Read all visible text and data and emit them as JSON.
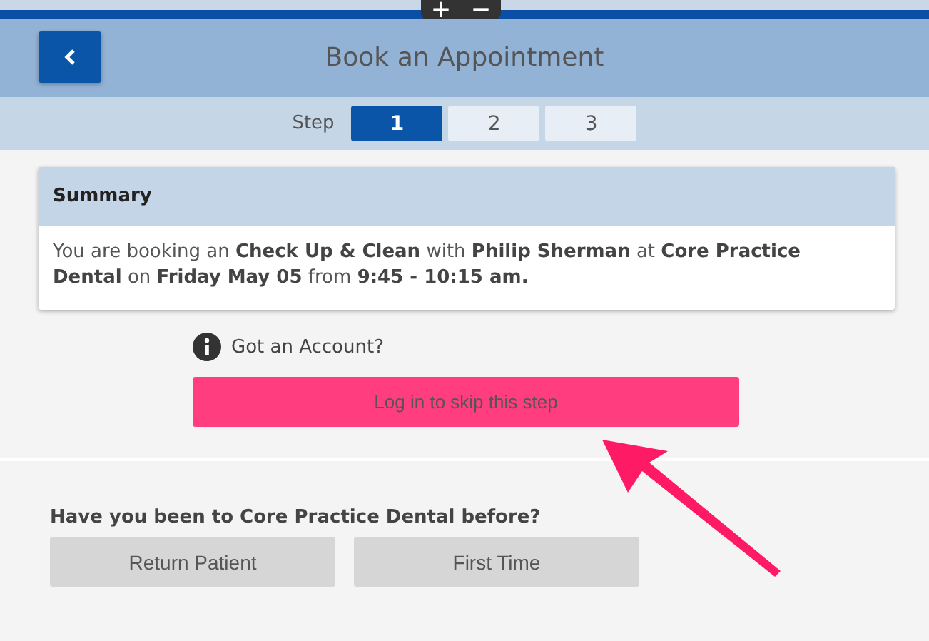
{
  "zoom_control": {
    "zoom_in": "+",
    "zoom_out": "−"
  },
  "header": {
    "title": "Book an Appointment"
  },
  "steps": {
    "label": "Step",
    "items": [
      {
        "label": "1",
        "selected": true
      },
      {
        "label": "2",
        "selected": false
      },
      {
        "label": "3",
        "selected": false
      }
    ]
  },
  "summary": {
    "title": "Summary",
    "text": "You are booking an **Check Up & Clean** with **Philip Sherman** at **Core Practice Dental** on **Friday May 05** from **9:45 - 10:15 am.**"
  },
  "account": {
    "prompt": "Got an Account?",
    "login_button": "Log in to skip this step"
  },
  "visit": {
    "question": "Have you been to Core Practice Dental before?",
    "options": [
      "Return Patient",
      "First Time"
    ]
  },
  "annotation": {
    "kind": "arrow"
  }
}
